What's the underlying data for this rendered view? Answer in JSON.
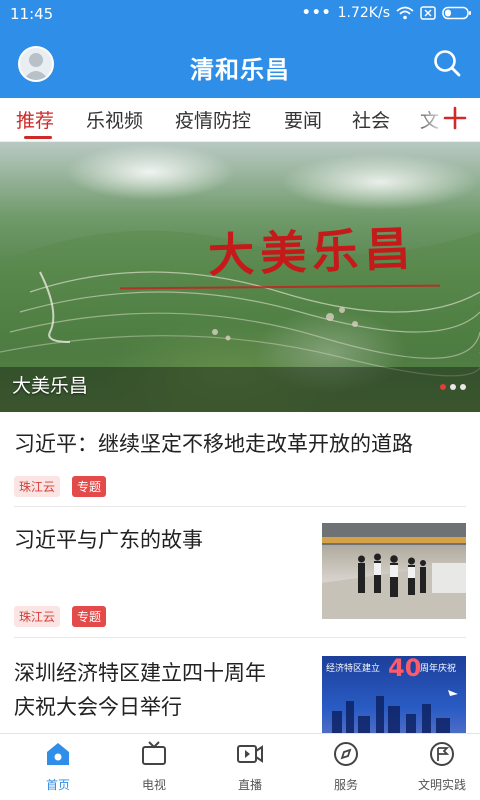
{
  "status_bar": {
    "time": "11:45",
    "network_speed": "1.72K/s"
  },
  "app_bar": {
    "title": "清和乐昌"
  },
  "tabs": [
    {
      "label": "推荐",
      "active": true
    },
    {
      "label": "乐视频"
    },
    {
      "label": "疫情防控"
    },
    {
      "label": "要闻"
    },
    {
      "label": "社会"
    },
    {
      "label": "文"
    }
  ],
  "banner": {
    "caption": "大美乐昌",
    "art_title": "大美乐昌",
    "slide_index": 1,
    "slide_count": 3
  },
  "articles": [
    {
      "headline": "习近平：继续坚定不移地走改革开放的道路",
      "source": "珠江云",
      "tag": "专题"
    },
    {
      "headline": "习近平与广东的故事",
      "source": "珠江云",
      "tag": "专题"
    },
    {
      "headline_line1": "深圳经济特区建立四十周年",
      "headline_line2": "庆祝大会今日举行",
      "thumb_text": "经济特区建立",
      "thumb_number": "40",
      "thumb_text2": "周年庆祝"
    }
  ],
  "bottom_nav": [
    {
      "label": "首页",
      "active": true
    },
    {
      "label": "电视"
    },
    {
      "label": "直播"
    },
    {
      "label": "服务"
    },
    {
      "label": "文明实践"
    }
  ],
  "colors": {
    "primary": "#2f8ee8",
    "accent_red": "#d02a28"
  }
}
